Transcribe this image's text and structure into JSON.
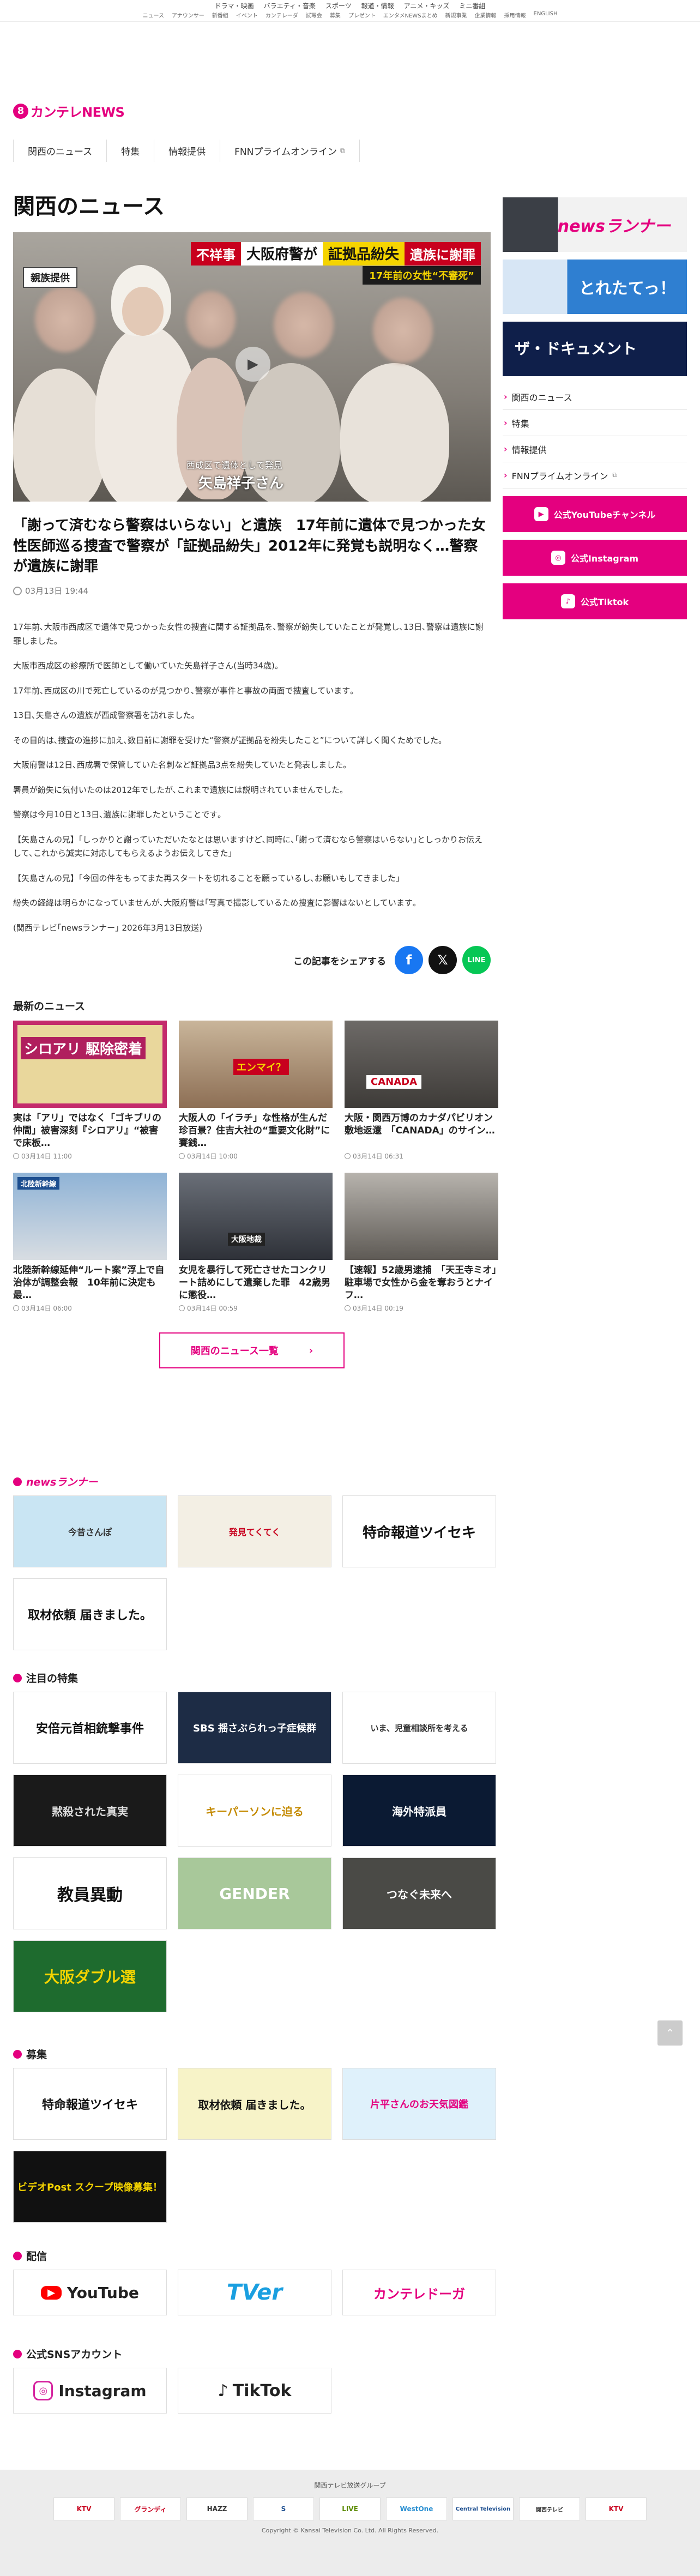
{
  "topbar": {
    "row1": [
      "ドラマ・映画",
      "バラエティ・音楽",
      "スポーツ",
      "報道・情報",
      "アニメ・キッズ",
      "ミニ番組"
    ],
    "row2": [
      "ニュース",
      "アナウンサー",
      "新番組",
      "イベント",
      "カンテレーダ",
      "試写会",
      "募集",
      "プレゼント",
      "エンタメNEWSまとめ",
      "新規事業",
      "企業情報",
      "採用情報",
      "ENGLISH"
    ]
  },
  "logo": {
    "mark": "8",
    "text": "カンテレNEWS"
  },
  "nav": {
    "items": [
      "関西のニュース",
      "特集",
      "情報提供",
      "FNNプライムオンライン"
    ]
  },
  "page_title": "関西のニュース",
  "hero": {
    "tag": "親族提供",
    "headline_red": "不祥事",
    "headline_white": "大阪府警が",
    "headline_yellow": "証拠品紛失",
    "headline_red2": "遺族に謝罪",
    "subline": "17年前の女性“不審死”",
    "caption_small": "西成区で遺体として発見",
    "caption_name": "矢島祥子さん"
  },
  "article": {
    "title": "「謝って済むなら警察はいらない」と遺族　17年前に遺体で見つかった女性医師巡る捜査で警察が「証拠品紛失」2012年に発覚も説明なく…警察が遺族に謝罪",
    "date": "03月13日 19:44",
    "paragraphs": [
      "17年前､大阪市西成区で遺体で見つかった女性の捜査に関する証拠品を､警察が紛失していたことが発覚し､13日､警察は遺族に謝罪しました｡",
      "大阪市西成区の診療所で医師として働いていた矢島祥子さん(当時34歳)｡",
      "17年前､西成区の川で死亡しているのが見つかり､警察が事件と事故の両面で捜査しています｡",
      "13日､矢島さんの遺族が西成警察署を訪れました｡",
      "その目的は､捜査の進捗に加え､数日前に謝罪を受けた“警察が証拠品を紛失したこと”について詳しく聞くためでした｡",
      "大阪府警は12日､西成署で保管していた名刺など証拠品3点を紛失していたと発表しました｡",
      "署員が紛失に気付いたのは2012年でしたが､これまで遺族には説明されていませんでした｡",
      "警察は今月10日と13日､遺族に謝罪したということです｡",
      "【矢島さんの兄】｢しっかりと謝っていただいたなとは思いますけど､同時に､｢謝って済むなら警察はいらない｣としっかりお伝えして､これから誠実に対応してもらえるようお伝えしてきた｣",
      "【矢島さんの兄】｢今回の件をもってまた再スタートを切れることを願っているし､お願いもしてきました｣",
      "紛失の経緯は明らかになっていませんが､大阪府警は｢写真で撮影しているため捜査に影響はないとしています｡",
      "(関西テレビ｢newsランナー｣ 2026年3月13日放送)"
    ],
    "share_label": "この記事をシェアする"
  },
  "latest": {
    "title": "最新のニュース",
    "items": [
      {
        "title": "実は「アリ」ではなく「ゴキブリの仲間」被害深刻『シロアリ』“被害で床板…",
        "date": "03月14日 11:00",
        "img_text": "シロアリ 駆除密着"
      },
      {
        "title": "大阪人の「イラチ」な性格が生んだ珍百景？住吉大社の“重要文化財”に賽銭…",
        "date": "03月14日 10:00",
        "img_text": "エンマイ？"
      },
      {
        "title": "大阪・関西万博のカナダパビリオン敷地返還　「CANADA」のサイン…",
        "date": "03月14日 06:31",
        "img_text": "CANADA"
      },
      {
        "title": "北陸新幹線延伸“ルート案”浮上で自治体が調整会報　10年前に決定も最…",
        "date": "03月14日 06:00",
        "img_text": "北陸新幹線"
      },
      {
        "title": "女児を暴行して死亡させたコンクリート詰めにして遺棄した罪　42歳男に懲役…",
        "date": "03月14日 00:59",
        "img_text": "大阪地裁"
      },
      {
        "title": "【速報】52歳男逮捕　「天王寺ミオ」駐車場で女性から金を奪おうとナイフ…",
        "date": "03月14日 00:19",
        "img_text": ""
      }
    ],
    "more_label": "関西のニュース一覧"
  },
  "runner": {
    "logo": "newsランナー",
    "items": [
      "今昔さんぽ",
      "発見てくてく",
      "特命報道ツイセキ",
      "取材依頼 届きました。"
    ]
  },
  "features": {
    "title": "注目の特集",
    "items": [
      "安倍元首相銃撃事件",
      "SBS 揺さぶられっ子症候群",
      "いま、児童相談所を考える",
      "黙殺された真実",
      "キーパーソンに迫る",
      "海外特派員",
      "教員異動",
      "GENDER",
      "つなぐ未来へ",
      "大阪ダブル選"
    ]
  },
  "recruit": {
    "title": "募集",
    "items": [
      "特命報道ツイセキ",
      "取材依頼 届きました。",
      "片平さんのお天気図鑑",
      "ビデオPost スクープ映像募集！"
    ]
  },
  "distribution": {
    "title": "配信",
    "items": [
      "YouTube",
      "TVer",
      "カンテレドーガ"
    ]
  },
  "sns": {
    "title": "公式SNSアカウント",
    "items": [
      "Instagram",
      "TikTok"
    ]
  },
  "sidebar": {
    "banners": [
      "newsランナー",
      "とれたてっ！",
      "ザ・ドキュメント"
    ],
    "links": [
      "関西のニュース",
      "特集",
      "情報提供",
      "FNNプライムオンライン"
    ],
    "buttons": [
      "公式YouTubeチャンネル",
      "公式Instagram",
      "公式Tiktok"
    ]
  },
  "footer": {
    "group_label": "関西テレビ放送グループ",
    "logos": [
      "KTV",
      "グランディ",
      "HAZZ",
      "S",
      "LIVE",
      "WestOne",
      "Central Television",
      "関西テレビ",
      "KTV"
    ],
    "copyright": "Copyright © Kansai Television Co. Ltd. All Rights Reserved."
  },
  "colors": {
    "accent": "#e4007f",
    "hero_red": "#c8001e",
    "hero_yellow": "#f5d400",
    "facebook": "#1877f2",
    "x": "#111111",
    "line": "#06c755"
  }
}
